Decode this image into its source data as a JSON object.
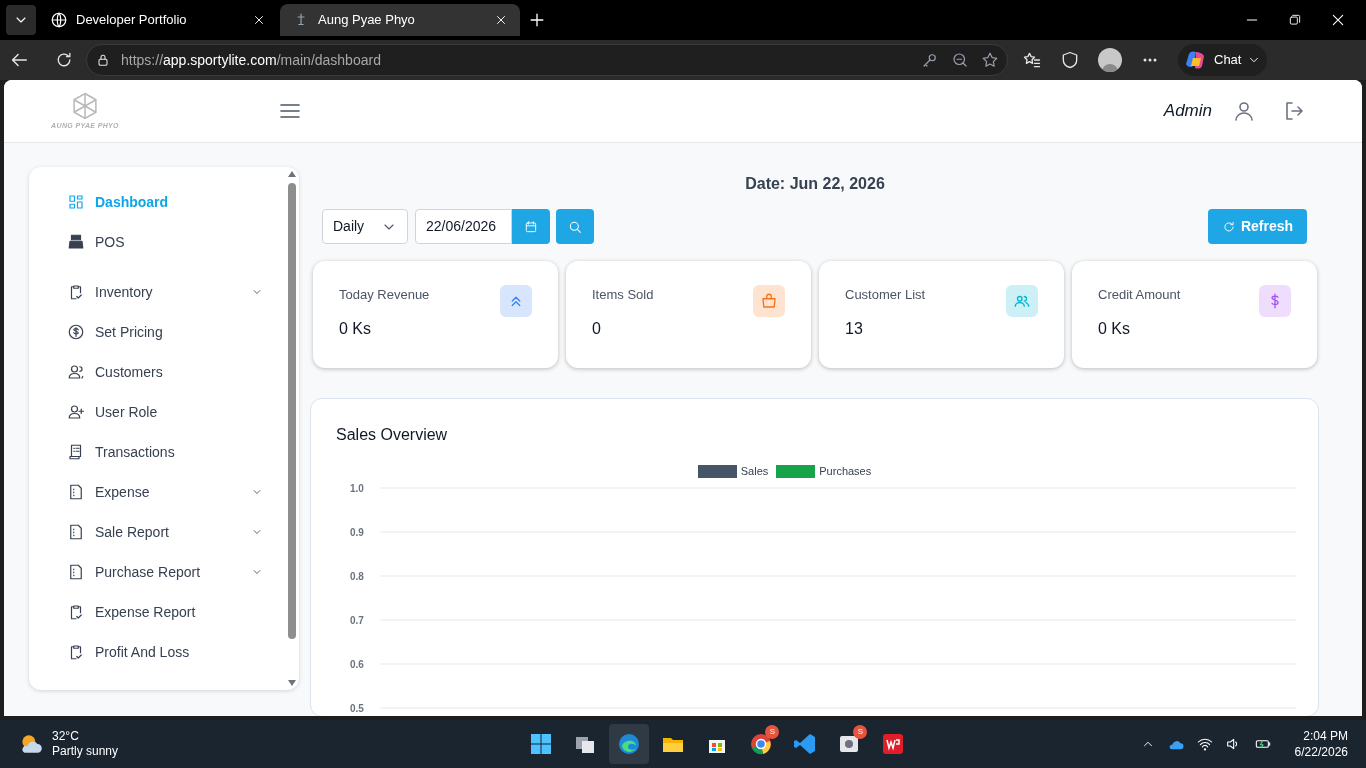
{
  "browser": {
    "tabs": [
      {
        "title": "Developer Portfolio",
        "selected": false
      },
      {
        "title": "Aung Pyae Phyo",
        "selected": true
      }
    ],
    "url": {
      "scheme": "https://",
      "host": "app.sportylite.com",
      "path": "/main/dashboard"
    },
    "chat_label": "Chat"
  },
  "header": {
    "logo_text": "AUNG PYAE PHYO",
    "user": "Admin"
  },
  "sidebar": {
    "items": [
      {
        "label": "Dashboard",
        "selected": true,
        "expandable": false
      },
      {
        "label": "POS",
        "selected": false,
        "expandable": false
      },
      {
        "label": "Inventory",
        "selected": false,
        "expandable": true
      },
      {
        "label": "Set Pricing",
        "selected": false,
        "expandable": false
      },
      {
        "label": "Customers",
        "selected": false,
        "expandable": false
      },
      {
        "label": "User Role",
        "selected": false,
        "expandable": false
      },
      {
        "label": "Transactions",
        "selected": false,
        "expandable": false
      },
      {
        "label": "Expense",
        "selected": false,
        "expandable": true
      },
      {
        "label": "Sale Report",
        "selected": false,
        "expandable": true
      },
      {
        "label": "Purchase Report",
        "selected": false,
        "expandable": true
      },
      {
        "label": "Expense Report",
        "selected": false,
        "expandable": false
      },
      {
        "label": "Profit And Loss",
        "selected": false,
        "expandable": false
      }
    ]
  },
  "filters": {
    "date_title": "Date: Jun 22, 2026",
    "period": "Daily",
    "date": "22/06/2026",
    "refresh_label": "Refresh"
  },
  "stats": [
    {
      "label": "Today Revenue",
      "value": "0 Ks",
      "color": "#3b82f6"
    },
    {
      "label": "Items Sold",
      "value": "0",
      "color": "#f97316"
    },
    {
      "label": "Customer List",
      "value": "13",
      "color": "#06b6d4"
    },
    {
      "label": "Credit Amount",
      "value": "0 Ks",
      "color": "#a855f7"
    }
  ],
  "sales_overview": {
    "title": "Sales Overview",
    "chart_data": {
      "type": "bar",
      "ylim": [
        0.5,
        1.0
      ],
      "grid": true,
      "yticks": [
        {
          "value": 1,
          "label": "1.0"
        },
        {
          "value": 0.9,
          "label": "0.9"
        },
        {
          "value": 0.8,
          "label": "0.8"
        },
        {
          "value": 0.7,
          "label": "0.7"
        },
        {
          "value": 0.6,
          "label": "0.6"
        },
        {
          "value": 0.5,
          "label": "0.5"
        }
      ],
      "series": [
        {
          "name": "Sales",
          "color": "#475569"
        },
        {
          "name": "Purchases",
          "color": "#16a34a"
        }
      ]
    }
  },
  "taskbar": {
    "temperature": "32°C",
    "weather": "Partly sunny",
    "badges": [
      "S",
      "S"
    ],
    "time": "2:04 PM",
    "date": "6/22/2026"
  }
}
